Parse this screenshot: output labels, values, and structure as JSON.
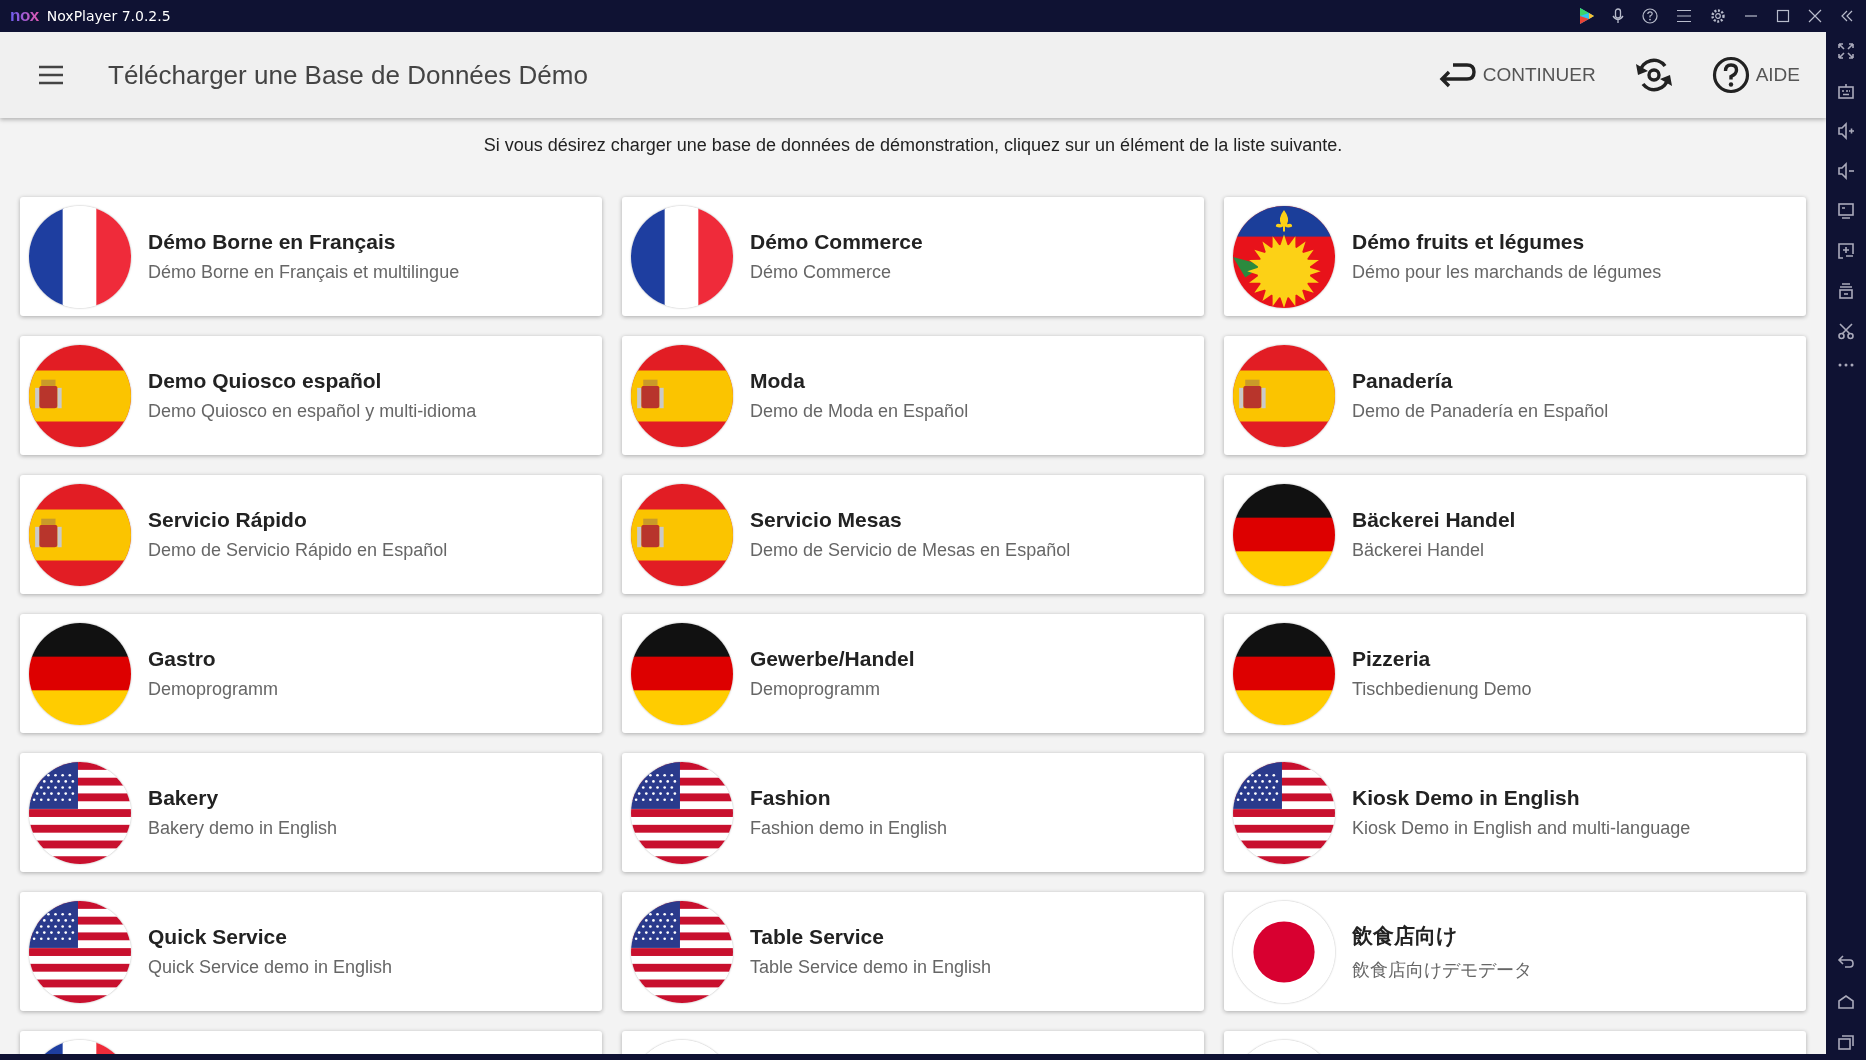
{
  "window": {
    "logo": "nox",
    "title": "NoxPlayer 7.0.2.5"
  },
  "header": {
    "title": "Télécharger une Base de Données Démo",
    "actions": [
      {
        "kind": "continue",
        "label": "CONTINUER"
      },
      {
        "kind": "sync"
      },
      {
        "kind": "help",
        "label": "AIDE"
      }
    ]
  },
  "instruction": "Si vous désirez charger une base de données de démonstration, cliquez sur un élément de la liste suivante.",
  "cards": [
    {
      "kind": "fr",
      "title": "Démo Borne en Français",
      "subtitle": "Démo Borne en Français et multilingue"
    },
    {
      "kind": "fr",
      "title": "Démo Commerce",
      "subtitle": "Démo Commerce"
    },
    {
      "kind": "gp",
      "title": "Démo fruits et légumes",
      "subtitle": "Démo pour les marchands de légumes"
    },
    {
      "kind": "es",
      "title": "Demo Quiosco español",
      "subtitle": "Demo Quiosco en español y multi-idioma"
    },
    {
      "kind": "es",
      "title": "Moda",
      "subtitle": "Demo de Moda en Español"
    },
    {
      "kind": "es",
      "title": "Panadería",
      "subtitle": "Demo de Panadería en Español"
    },
    {
      "kind": "es",
      "title": "Servicio Rápido",
      "subtitle": "Demo de Servicio Rápido en Español"
    },
    {
      "kind": "es",
      "title": "Servicio Mesas",
      "subtitle": "Demo de Servicio de Mesas en Español"
    },
    {
      "kind": "de",
      "title": "Bäckerei Handel",
      "subtitle": "Bäckerei Handel"
    },
    {
      "kind": "de",
      "title": "Gastro",
      "subtitle": "Demoprogramm"
    },
    {
      "kind": "de",
      "title": "Gewerbe/Handel",
      "subtitle": "Demoprogramm"
    },
    {
      "kind": "de",
      "title": "Pizzeria",
      "subtitle": "Tischbedienung Demo"
    },
    {
      "kind": "us",
      "title": "Bakery",
      "subtitle": "Bakery demo in English"
    },
    {
      "kind": "us",
      "title": "Fashion",
      "subtitle": "Fashion demo in English"
    },
    {
      "kind": "us",
      "title": "Kiosk Demo in English",
      "subtitle": "Kiosk Demo in English and multi-language"
    },
    {
      "kind": "us",
      "title": "Quick Service",
      "subtitle": "Quick Service demo in English"
    },
    {
      "kind": "us",
      "title": "Table Service",
      "subtitle": "Table Service demo in English"
    },
    {
      "kind": "jp",
      "title": "飲食店向け",
      "subtitle": "飲食店向けデモデータ"
    },
    {
      "kind": "fr"
    },
    {
      "kind": "plain"
    },
    {
      "kind": "plain"
    }
  ]
}
